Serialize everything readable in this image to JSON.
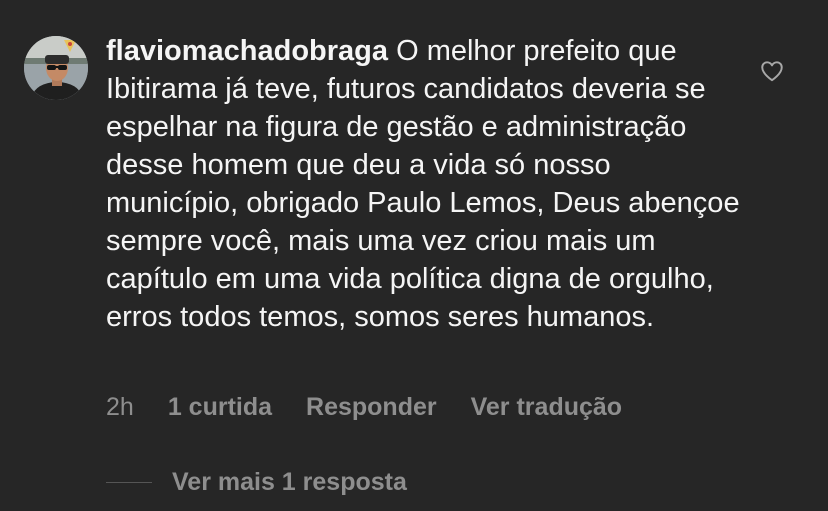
{
  "comment": {
    "username": "flaviomachadobraga",
    "text": " O melhor prefeito que Ibitirama já teve, futuros candidatos deveria se espelhar na figura de gestão e administração desse homem que deu a vida só nosso município, obrigado Paulo Lemos, Deus abençoe sempre você, mais uma vez criou mais um capítulo em uma vida política digna de orgulho, erros todos temos, somos seres humanos.",
    "avatar_icon": "user-avatar",
    "like_icon": "heart-outline-icon"
  },
  "meta": {
    "time": "2h",
    "likes": "1 curtida",
    "reply": "Responder",
    "translate": "Ver tradução"
  },
  "replies": {
    "label": "Ver mais 1 resposta"
  },
  "colors": {
    "background": "#262626",
    "text": "#f5f5f5",
    "secondary_text": "#8e8e8e"
  }
}
